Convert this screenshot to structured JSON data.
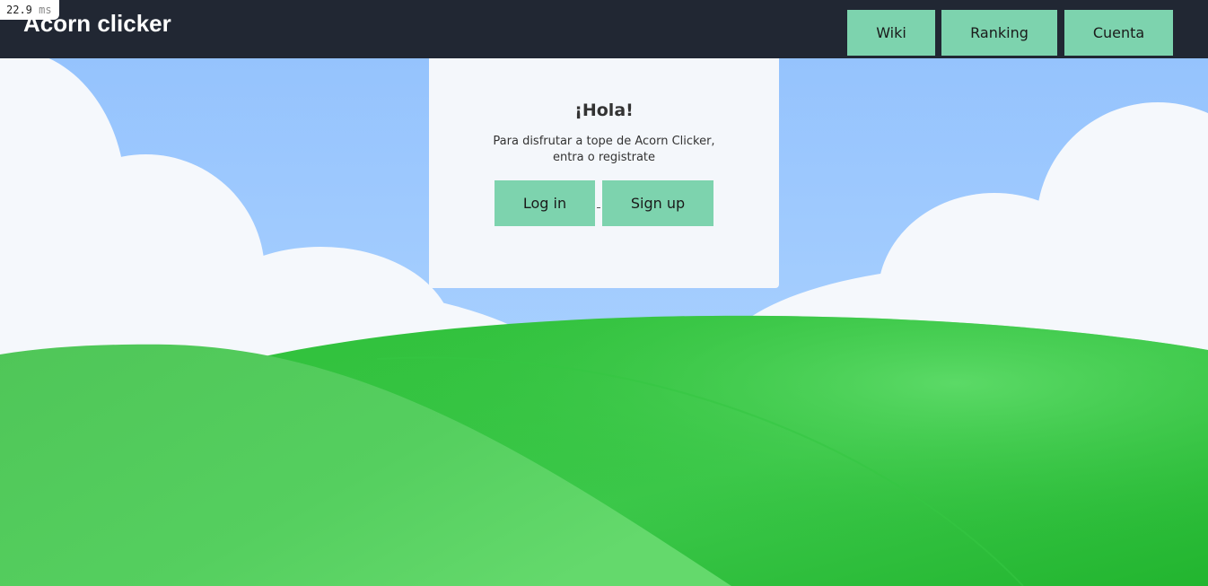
{
  "header": {
    "title": "Acorn clicker",
    "nav": [
      {
        "label": "Wiki"
      },
      {
        "label": "Ranking"
      },
      {
        "label": "Cuenta"
      }
    ]
  },
  "timing": {
    "value": "22.9",
    "unit": "ms"
  },
  "card": {
    "heading": "¡Hola!",
    "text": "Para disfrutar a tope de Acorn Clicker, entra o registrate",
    "login_label": "Log in",
    "signup_label": "Sign up"
  },
  "colors": {
    "header_bg": "#212733",
    "button_bg": "#7dd3ae",
    "sky": "#9ec8ff",
    "hill": "#2fbf3a"
  }
}
